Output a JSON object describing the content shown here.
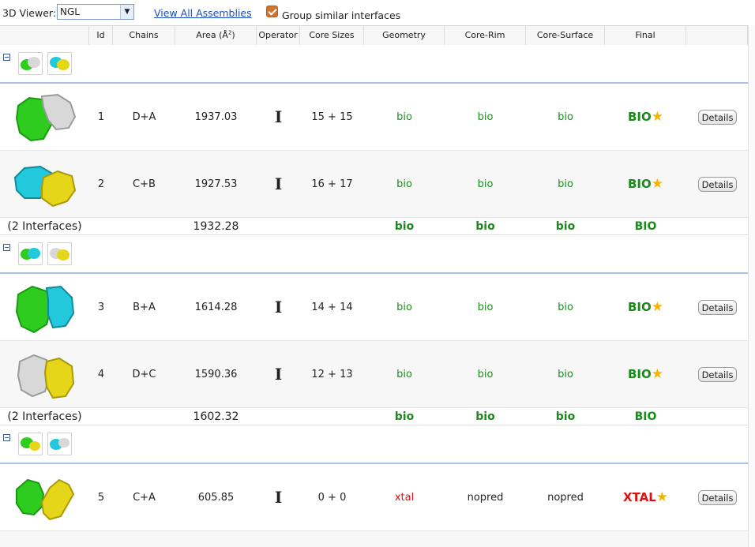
{
  "toolbar": {
    "viewer_label": "3D Viewer:",
    "viewer_value": "NGL",
    "assemblies_link": "View All Assemblies",
    "group_label": "Group similar interfaces"
  },
  "columns": [
    "Id",
    "Chains",
    "Area (Å²)",
    "Operator",
    "Core Sizes",
    "Geometry",
    "Core-Rim",
    "Core-Surface",
    "Final"
  ],
  "area_label": "Area (Å",
  "area_sup": "2",
  "area_close": ")",
  "groups": [
    {
      "rows": [
        {
          "id": "1",
          "chains": "D+A",
          "area": "1937.03",
          "op": "I",
          "core": "15 + 15",
          "geom": "bio",
          "rim": "bio",
          "surf": "bio",
          "final": "BIO",
          "details": "Details"
        },
        {
          "id": "2",
          "chains": "C+B",
          "area": "1927.53",
          "op": "I",
          "core": "16 + 17",
          "geom": "bio",
          "rim": "bio",
          "surf": "bio",
          "final": "BIO",
          "details": "Details"
        }
      ],
      "summary": {
        "label": "(2 Interfaces)",
        "area": "1932.28",
        "geom": "bio",
        "rim": "bio",
        "surf": "bio",
        "final": "BIO"
      }
    },
    {
      "rows": [
        {
          "id": "3",
          "chains": "B+A",
          "area": "1614.28",
          "op": "I",
          "core": "14 + 14",
          "geom": "bio",
          "rim": "bio",
          "surf": "bio",
          "final": "BIO",
          "details": "Details"
        },
        {
          "id": "4",
          "chains": "D+C",
          "area": "1590.36",
          "op": "I",
          "core": "12 + 13",
          "geom": "bio",
          "rim": "bio",
          "surf": "bio",
          "final": "BIO",
          "details": "Details"
        }
      ],
      "summary": {
        "label": "(2 Interfaces)",
        "area": "1602.32",
        "geom": "bio",
        "rim": "bio",
        "surf": "bio",
        "final": "BIO"
      }
    },
    {
      "rows": [
        {
          "id": "5",
          "chains": "C+A",
          "area": "605.85",
          "op": "I",
          "core": "0 + 0",
          "geom": "xtal",
          "rim": "nopred",
          "surf": "nopred",
          "final": "XTAL",
          "details": "Details"
        }
      ]
    }
  ],
  "colors": {
    "bio_green": "#1e8b1e",
    "xtal_red": "#dd1010",
    "chain_green": "#2ecc1f",
    "chain_white": "#d8d8d8",
    "chain_cyan": "#22c8dc",
    "chain_yellow": "#e6d619",
    "star": "#f4b400"
  },
  "icons": [
    "collapse-icon",
    "star-icon",
    "dropdown-arrow-icon",
    "checkbox-icon"
  ]
}
